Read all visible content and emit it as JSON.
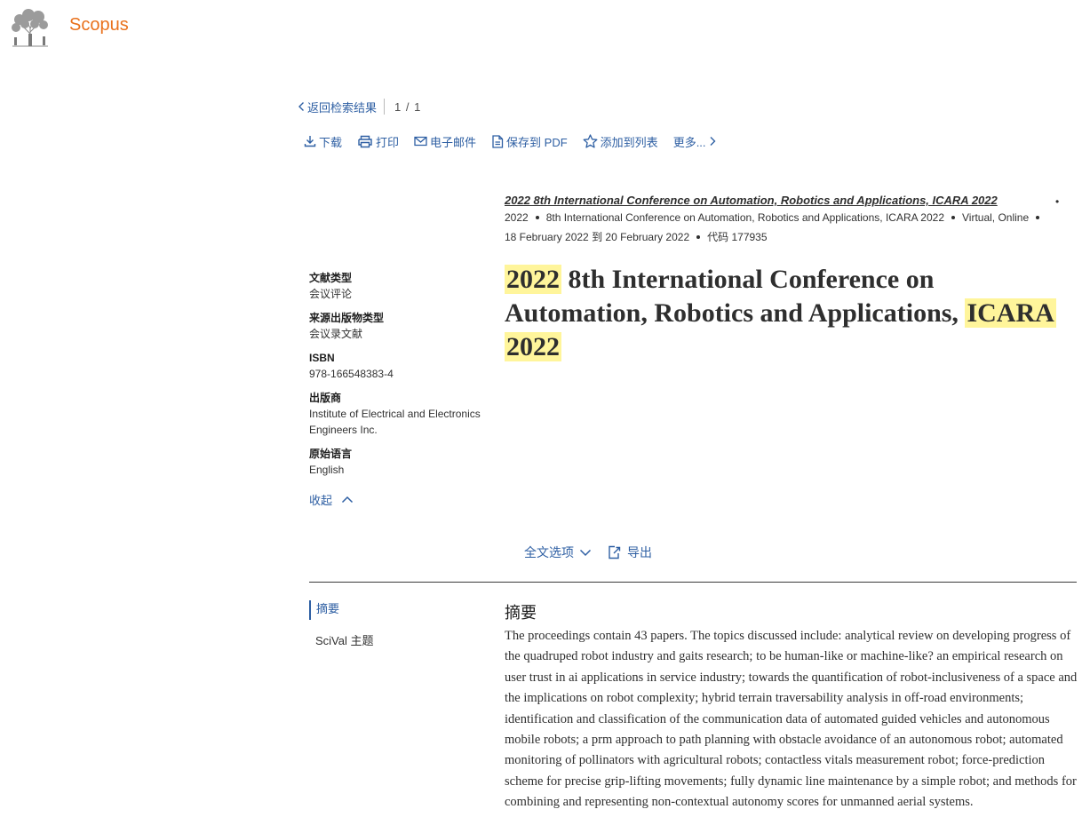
{
  "brand": {
    "name": "Scopus"
  },
  "nav": {
    "back_label": "返回检索结果",
    "pager": "1 / 1"
  },
  "toolbar": {
    "download": "下载",
    "print": "打印",
    "email": "电子邮件",
    "save_pdf": "保存到 PDF",
    "add_to_list": "添加到列表",
    "more": "更多..."
  },
  "source": {
    "title": "2022 8th International Conference on Automation, Robotics and Applications, ICARA 2022",
    "year": "2022",
    "conf_name": "8th International Conference on Automation, Robotics and Applications, ICARA 2022",
    "location": "Virtual, Online",
    "dates": "18 February 2022 到 20 February 2022",
    "code": "代码 177935"
  },
  "details": {
    "doc_type_label": "文献类型",
    "doc_type_value": "会议评论",
    "source_type_label": "来源出版物类型",
    "source_type_value": "会议录文献",
    "isbn_label": "ISBN",
    "isbn_value": "978-166548383-4",
    "publisher_label": "出版商",
    "publisher_value": "Institute of Electrical and Electronics Engineers Inc.",
    "language_label": "原始语言",
    "language_value": "English",
    "collapse_label": "收起"
  },
  "title": {
    "part1_hl": "2022",
    "part2": " 8th International Conference on Automation, Robotics and Applications, ",
    "part3_hl": "ICARA",
    "part4_hl": "2022"
  },
  "fulltext": {
    "options_label": "全文选项",
    "export_label": "导出"
  },
  "tabs": {
    "abstract": "摘要",
    "scival": "SciVal 主题"
  },
  "abstract": {
    "heading": "摘要",
    "text": "The proceedings contain 43 papers. The topics discussed include: analytical review on developing progress of the quadruped robot industry and gaits research; to be human-like or machine-like? an empirical research on user trust in ai applications in service industry; towards the quantification of robot-inclusiveness of a space and the implications on robot complexity; hybrid terrain traversability analysis in off-road environments; identification and classification of the communication data of automated guided vehicles and autonomous mobile robots; a prm approach to path planning with obstacle avoidance of an autonomous robot; automated monitoring of pollinators with agricultural robots; contactless vitals measurement robot; force-prediction scheme for precise grip-lifting movements; fully dynamic line maintenance by a simple robot; and methods for combining and representing non-contextual autonomy scores for unmanned aerial systems."
  },
  "colors": {
    "brand": "#e9711c",
    "link": "#2e5fa3",
    "highlight": "#fff59b"
  }
}
